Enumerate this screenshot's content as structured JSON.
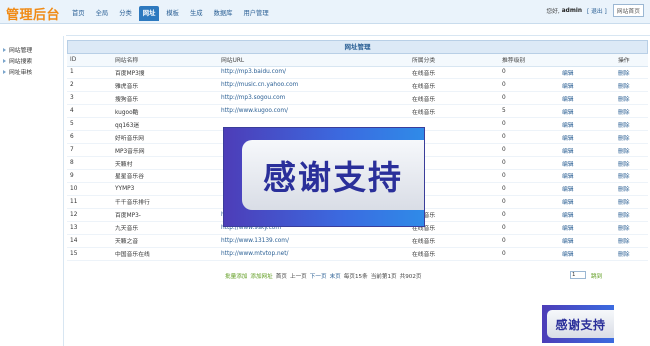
{
  "header": {
    "logo": "管理后台",
    "nav": [
      "首页",
      "全局",
      "分类",
      "网址",
      "模板",
      "生成",
      "数据库",
      "用户管理"
    ],
    "nav_active_index": 3,
    "greeting": "您好,",
    "username": "admin",
    "logout": "[ 退出 ]",
    "home": "网站首页"
  },
  "sidebar": {
    "items": [
      "网站管理",
      "网站搜索",
      "网址审核"
    ]
  },
  "panel": {
    "title": "网址管理"
  },
  "table": {
    "headers": [
      "ID",
      "网站名称",
      "网站URL",
      "所属分类",
      "推荐级别",
      "",
      "操作"
    ],
    "edit_label": "编辑",
    "delete_label": "删除",
    "rows": [
      {
        "id": "1",
        "name": "百度MP3搜",
        "url": "http://mp3.baidu.com/",
        "cat": "在线音乐",
        "rank": "0"
      },
      {
        "id": "2",
        "name": "雅虎音乐",
        "url": "http://music.cn.yahoo.com",
        "cat": "在线音乐",
        "rank": "0"
      },
      {
        "id": "3",
        "name": "搜狗音乐",
        "url": "http://mp3.sogou.com",
        "cat": "在线音乐",
        "rank": "0"
      },
      {
        "id": "4",
        "name": "kugoo酷",
        "url": "http://www.kugoo.com/",
        "cat": "在线音乐",
        "rank": "5"
      },
      {
        "id": "5",
        "name": "qq163迷",
        "url": "",
        "cat": "",
        "rank": "0"
      },
      {
        "id": "6",
        "name": "好听音乐网",
        "url": "",
        "cat": "",
        "rank": "0"
      },
      {
        "id": "7",
        "name": "MP3音乐网",
        "url": "",
        "cat": "",
        "rank": "0"
      },
      {
        "id": "8",
        "name": "天籁村",
        "url": "",
        "cat": "",
        "rank": "0"
      },
      {
        "id": "9",
        "name": "星星音乐谷",
        "url": "",
        "cat": "",
        "rank": "0"
      },
      {
        "id": "10",
        "name": "YYMP3",
        "url": "",
        "cat": "",
        "rank": "0"
      },
      {
        "id": "11",
        "name": "千千音乐排行",
        "url": "",
        "cat": "",
        "rank": "0"
      },
      {
        "id": "12",
        "name": "百度MP3-",
        "url": "http://list.mp3.baidu.com/tops",
        "cat": "在线音乐",
        "rank": "0"
      },
      {
        "id": "13",
        "name": "九天音乐",
        "url": "http://www.9sky.com",
        "cat": "在线音乐",
        "rank": "0"
      },
      {
        "id": "14",
        "name": "天籁之音",
        "url": "http://www.13139.com/",
        "cat": "在线音乐",
        "rank": "0"
      },
      {
        "id": "15",
        "name": "中国音乐在线",
        "url": "http://www.mtvtop.net/",
        "cat": "在线音乐",
        "rank": "0"
      }
    ]
  },
  "pager": {
    "batch_add": "批量添加",
    "add_url": "添加网址",
    "first": "首页",
    "prev": "上一页",
    "next": "下一页",
    "last": "末页",
    "per_page": "每页15条",
    "current": "当前第1页",
    "total": "共902页",
    "page_input": "1",
    "go": "跳到"
  },
  "watermark": {
    "text": "感谢支持"
  }
}
